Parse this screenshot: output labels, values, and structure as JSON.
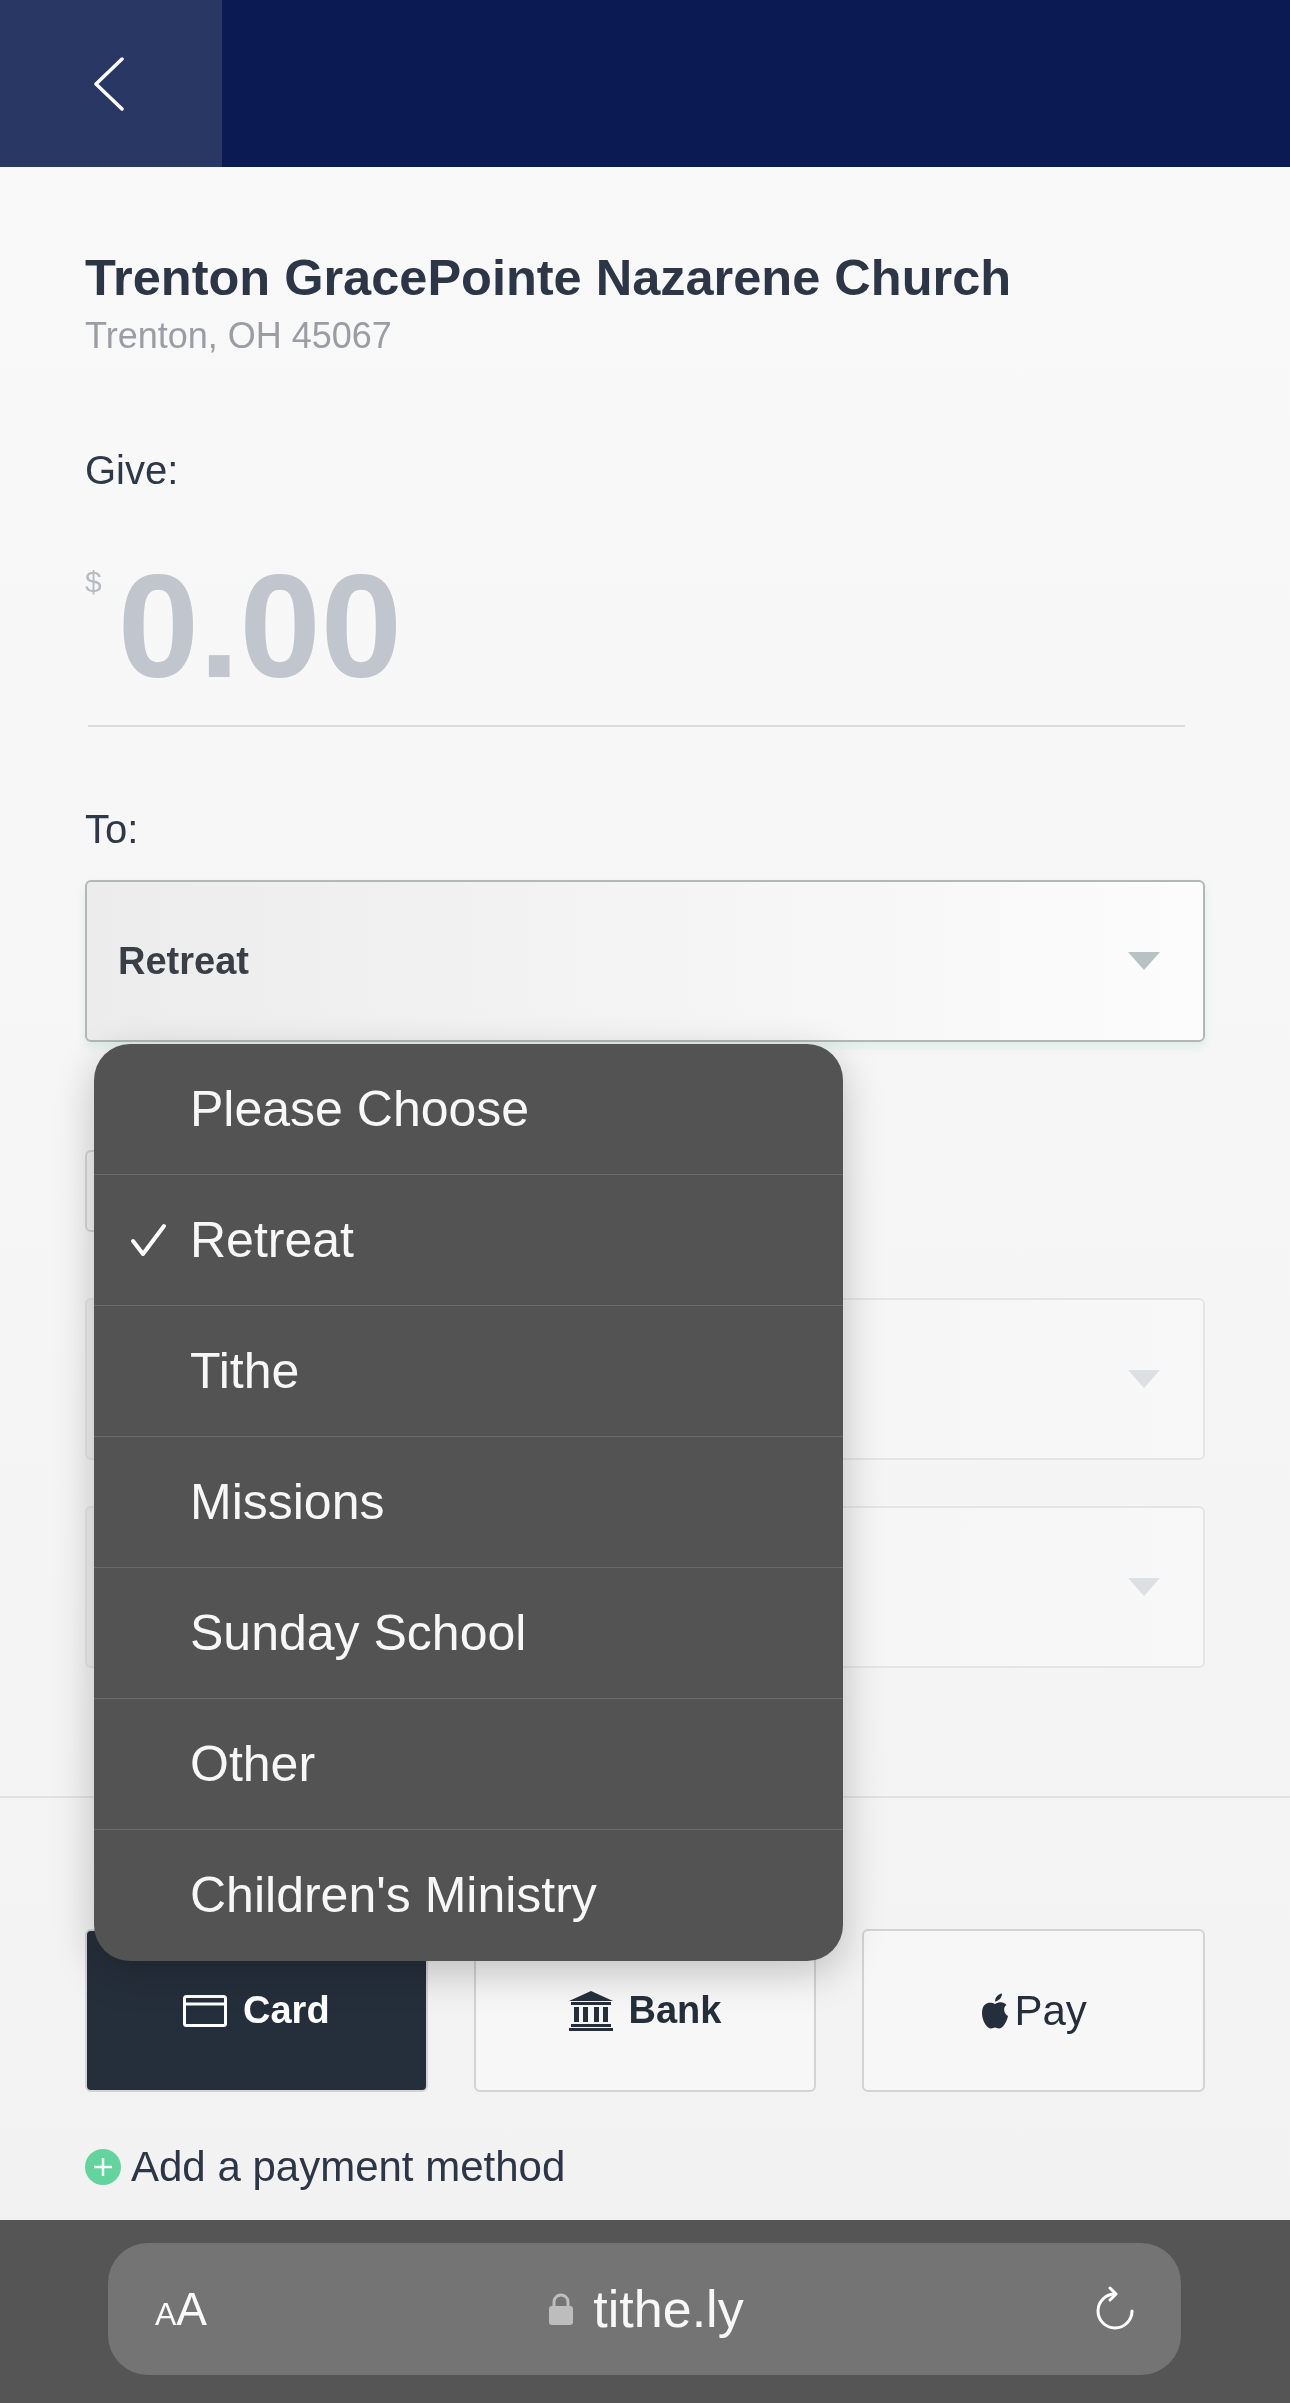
{
  "organization": {
    "name": "Trenton GracePointe Nazarene Church",
    "location": "Trenton, OH 45067"
  },
  "amount": {
    "label": "Give:",
    "currency": "$",
    "placeholder": "0.00"
  },
  "designation": {
    "label": "To:",
    "value": "Retreat"
  },
  "covered_fields": [
    {
      "kind": "input"
    },
    {
      "kind": "select"
    },
    {
      "kind": "select"
    }
  ],
  "dropdown": {
    "options": [
      {
        "label": "Please Choose",
        "selected": false
      },
      {
        "label": "Retreat",
        "selected": true
      },
      {
        "label": "Tithe",
        "selected": false
      },
      {
        "label": "Missions",
        "selected": false
      },
      {
        "label": "Sunday School",
        "selected": false
      },
      {
        "label": "Other",
        "selected": false
      },
      {
        "label": "Children's Ministry",
        "selected": false
      }
    ]
  },
  "payment_methods": [
    {
      "kind": "card",
      "label": "Card",
      "selected": true
    },
    {
      "kind": "bank",
      "label": "Bank",
      "selected": false
    },
    {
      "kind": "apple_pay",
      "label": "Pay",
      "selected": false
    }
  ],
  "add_payment_method": {
    "label": "Add a payment method"
  },
  "browser_bar": {
    "text_size_button": "AA",
    "url": "tithe.ly"
  }
}
